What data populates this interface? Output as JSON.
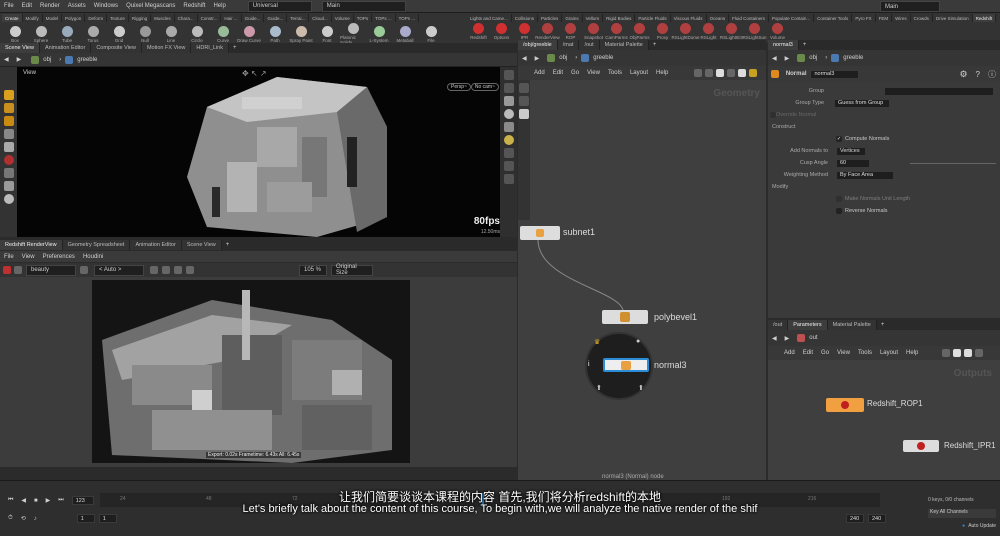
{
  "menubar": {
    "items": [
      "File",
      "Edit",
      "Render",
      "Assets",
      "Windows",
      "Quixel Megascans",
      "Redshift",
      "Help"
    ],
    "desktop": "Universal",
    "network": "Main",
    "right_title": "Main"
  },
  "shelf_left": {
    "tabs": [
      "Create",
      "Modify",
      "Model",
      "Polygon",
      "Deform",
      "Texture",
      "Rigging",
      "Muscles",
      "Chara...",
      "Constr...",
      "Hair ...",
      "Guide...",
      "Guide...",
      "Terrai...",
      "Cloud...",
      "Volume",
      "TOPs",
      "TOPs ...",
      "TOPs ..."
    ],
    "tools": [
      "Box",
      "Sphere",
      "Tube",
      "Torus",
      "Grid",
      "Null",
      "Line",
      "Circle",
      "Curve",
      "Draw Curve",
      "Path",
      "Spray Paint",
      "Font",
      "Platonic Solids",
      "L-System",
      "Metaball",
      "File"
    ]
  },
  "shelf_right": {
    "tabs": [
      "Lights and Came...",
      "Collisions",
      "Particles",
      "Grains",
      "Vellum",
      "Rigid Bodies",
      "Particle Fluids",
      "Viscous Fluids",
      "Oceans",
      "Fluid Containers",
      "Populate Contain...",
      "Container Tools",
      "Pyro FX",
      "FEM",
      "Wires",
      "Crowds",
      "Drive Simulation",
      "Redshift",
      "Scripts"
    ],
    "tools": [
      "Redshift",
      "Options",
      "IPR",
      "RenderView",
      "ROP",
      "Snapshot",
      "CamParms",
      "ObjParms",
      "Proxy",
      "RSLightDome",
      "RSLight",
      "RSLightIES",
      "RSLightSun",
      "Volume"
    ]
  },
  "left_top_tabs": [
    "Scene View",
    "Animation Editor",
    "Composite View",
    "Motion FX View",
    "HDRI_Link"
  ],
  "viewport": {
    "path": "obj",
    "node": "greeble",
    "label": "View",
    "persp": "Persp~",
    "cam": "No cam~",
    "fps": "80fps",
    "ms": "12.50ms"
  },
  "left_bottom_tabs": [
    "Redshift RenderView",
    "Geometry Spreadsheet",
    "Animation Editor",
    "Scene View"
  ],
  "renderview": {
    "menu": [
      "File",
      "View",
      "Preferences",
      "Houdini"
    ],
    "beauty": "beauty",
    "auto": "< Auto >",
    "zoom": "105 %",
    "size": "Original Size",
    "status": "Export: 0.02s  Frametime: 6.43s  All: 6.45s"
  },
  "network": {
    "tabs": [
      "/obj/greeble",
      "/mat",
      "/out",
      "Material Palette"
    ],
    "path_obj": "obj",
    "path_node": "greeble",
    "menu": [
      "Add",
      "Edit",
      "Go",
      "View",
      "Tools",
      "Layout",
      "Help"
    ],
    "context": "Geometry",
    "nodes": {
      "subnet": "subnet1",
      "polybevel": "polybevel1",
      "normal": "normal3"
    },
    "footer": "normal3 (Normal) node"
  },
  "params": {
    "tabs": [
      "normal3"
    ],
    "path_obj": "obj",
    "path_node": "greeble",
    "type": "Normal",
    "name": "normal3",
    "rows": {
      "group": "Group",
      "group_type": "Group Type",
      "group_type_val": "Guess from Group",
      "override": "Override Normal",
      "construct": "Construct",
      "compute": "Compute Normals",
      "add_to": "Add Normals to",
      "add_to_val": "Vertices",
      "cusp": "Cusp Angle",
      "cusp_val": "60",
      "weighting": "Weighting Method",
      "weighting_val": "By Face Area",
      "modify": "Modify",
      "make_unit": "Make Normals Unit Length",
      "reverse": "Reverse Normals"
    }
  },
  "out_panel": {
    "tabs": [
      "/out",
      "Parameters",
      "Material Palette"
    ],
    "path": "out",
    "menu": [
      "Add",
      "Edit",
      "Go",
      "View",
      "Tools",
      "Layout",
      "Help"
    ],
    "context": "Outputs",
    "rop": "Redshift_ROP1",
    "ipr": "Redshift_IPR1"
  },
  "timeline": {
    "frame": "123",
    "start": "1",
    "start2": "1",
    "end": "240",
    "end2": "240",
    "ticks": [
      "24",
      "48",
      "72",
      "96",
      "120",
      "144",
      "168",
      "192",
      "216"
    ],
    "keys": "0 keys, 0/0 channels",
    "key_all": "Key All Channels",
    "auto_update": "Auto Update"
  },
  "subtitles": {
    "zh": "让我们简要谈谈本课程的内容 首先,我们将分析redshift的本地",
    "en": "Let's briefly talk about the content of this course, To begin with,we will analyze the native render of the shif"
  },
  "colors": {
    "accent_orange": "#e08a1e",
    "node_blue": "#2d8cd6",
    "node_purple": "#7a5fc0",
    "rop_orange": "#f0a040"
  }
}
